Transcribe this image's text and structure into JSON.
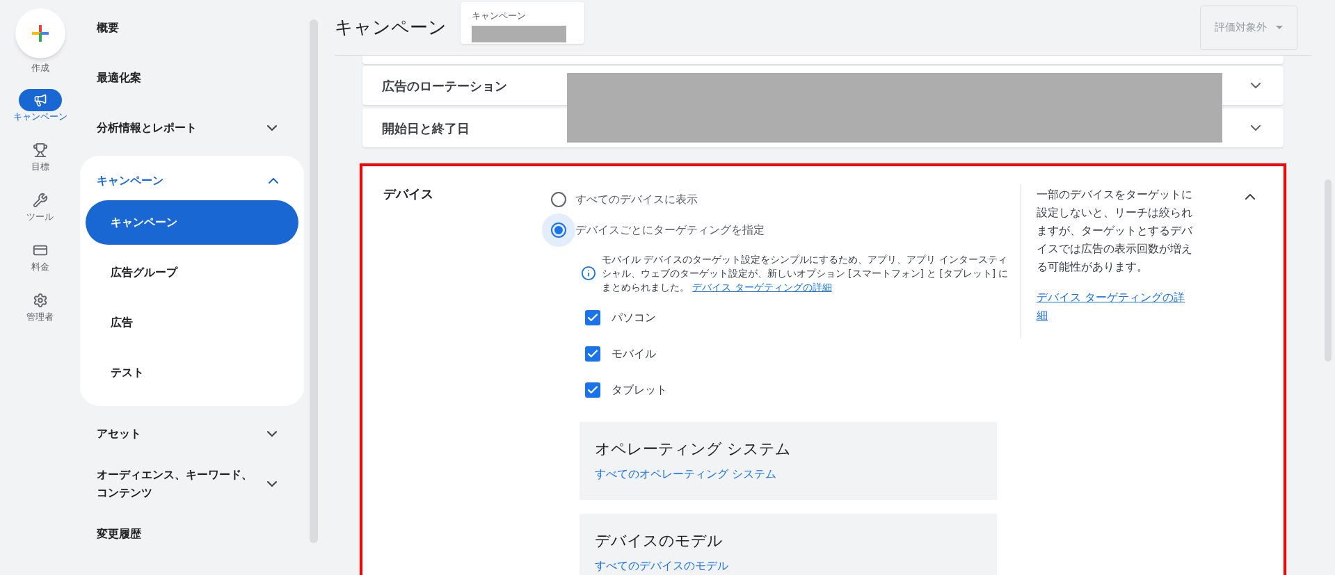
{
  "rail": [
    {
      "kind": "create",
      "label": "作成",
      "selected": false
    },
    {
      "kind": "campaign",
      "label": "キャンペーン",
      "selected": true
    },
    {
      "kind": "goals",
      "label": "目標",
      "selected": false
    },
    {
      "kind": "tools",
      "label": "ツール",
      "selected": false
    },
    {
      "kind": "billing",
      "label": "料金",
      "selected": false
    },
    {
      "kind": "admin",
      "label": "管理者",
      "selected": false
    }
  ],
  "sidebar": {
    "items": [
      {
        "label": "概要",
        "selected": false
      },
      {
        "label": "最適化案",
        "selected": false
      },
      {
        "label": "分析情報とレポート",
        "selected": false,
        "expanded": false
      },
      {
        "label": "キャンペーン",
        "selected": true,
        "expanded": true,
        "children": [
          {
            "label": "キャンペーン",
            "selected": true
          },
          {
            "label": "広告グループ",
            "selected": false
          },
          {
            "label": "広告",
            "selected": false
          },
          {
            "label": "テスト",
            "selected": false
          }
        ]
      },
      {
        "label": "アセット",
        "selected": false,
        "expanded": false
      },
      {
        "label": "オーディエンス、キーワード、コンテンツ",
        "selected": false,
        "expanded": false
      },
      {
        "label": "変更履歴",
        "selected": false
      }
    ]
  },
  "header": {
    "title": "キャンペーン",
    "campaign_picker": {
      "label": "キャンペーン"
    },
    "status_dropdown": {
      "value": "評価対象外",
      "disabled": true
    }
  },
  "sections": [
    {
      "title": "広告のローテーション",
      "expanded": false
    },
    {
      "title": "開始日と終了日",
      "expanded": false
    }
  ],
  "device_section": {
    "title": "デバイス",
    "expanded": true,
    "options": [
      {
        "label": "すべてのデバイスに表示",
        "selected": false
      },
      {
        "label": "デバイスごとにターゲティングを指定",
        "selected": true
      }
    ],
    "info": {
      "text": "モバイル デバイスのターゲット設定をシンプルにするため、アプリ、アプリ インタースティシャル、ウェブのターゲット設定が、新しいオプション [スマートフォン] と [タブレット] にまとめられました。",
      "link": "デバイス ターゲティングの詳細"
    },
    "checkboxes": [
      {
        "label": "パソコン",
        "checked": true
      },
      {
        "label": "モバイル",
        "checked": true
      },
      {
        "label": "タブレット",
        "checked": true
      }
    ],
    "help": {
      "text": "一部のデバイスをターゲットに設定しないと、リーチは絞られますが、ターゲットとするデバイスでは広告の表示回数が増える可能性があります。",
      "link": "デバイス ターゲティングの詳細"
    },
    "subsections": [
      {
        "title": "オペレーティング システム",
        "link": "すべてのオペレーティング システム"
      },
      {
        "title": "デバイスのモデル",
        "link": "すべてのデバイスのモデル"
      }
    ]
  }
}
